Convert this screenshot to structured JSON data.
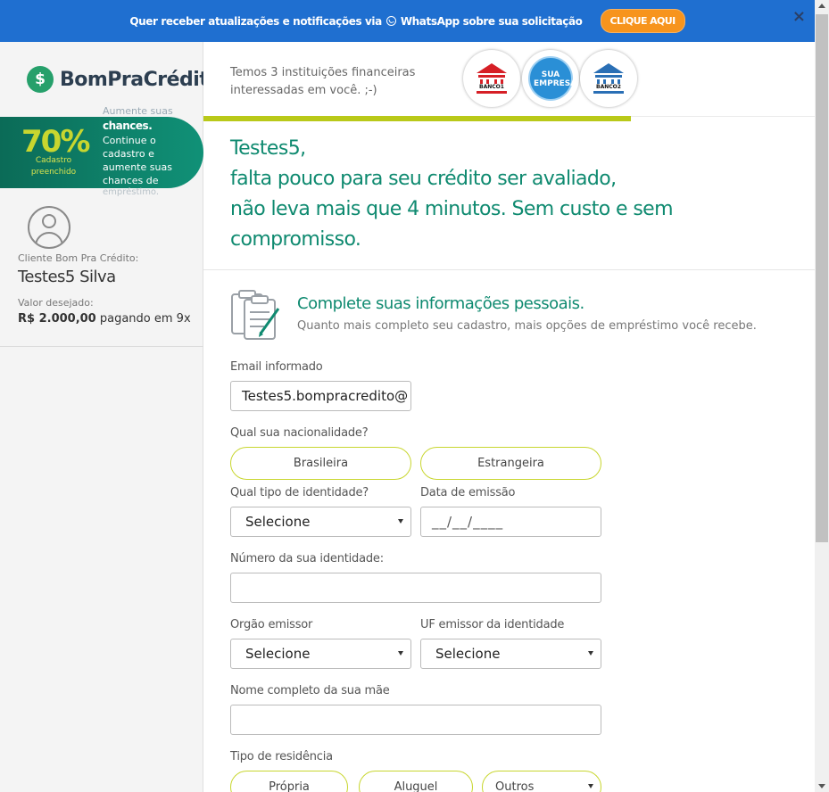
{
  "banner": {
    "text_before": "Quer receber atualizações e notificações via",
    "text_after": "WhatsApp sobre sua solicitação",
    "button": "CLIQUE AQUI",
    "close": "×"
  },
  "sidebar": {
    "logo_symbol": "$",
    "logo_text": "BomPraCrédito",
    "progress": {
      "percent_text": "70%",
      "percent_value": 70,
      "caption": "Cadastro preenchido",
      "faded_line": "Aumente suas",
      "strong_line": "chances.",
      "body": "Continue o cadastro e aumente suas chances de",
      "faded_tail": "empréstimo."
    },
    "client_label": "Cliente Bom Pra Crédito:",
    "client_name": "Testes5 Silva",
    "valor_label": "Valor desejado:",
    "valor_amount": "R$ 2.000,00",
    "valor_terms": "pagando em 9x"
  },
  "institutions": {
    "text": "Temos 3 instituições financeiras interessadas em você. ;-)",
    "banks": [
      {
        "label": "BANCO1",
        "color": "#d61f26"
      },
      {
        "label": "SUA EMPRESA",
        "color": "#2a8fd6"
      },
      {
        "label": "BANCO2",
        "color": "#2a6fb5"
      }
    ]
  },
  "headline": {
    "line1": "Testes5,",
    "line2": "falta pouco para seu crédito ser avaliado,",
    "line3": "não leva mais que 4 minutos. Sem custo e sem",
    "line4": "compromisso."
  },
  "section": {
    "title": "Complete suas informações pessoais.",
    "subtitle": "Quanto mais completo seu cadastro, mais opções de empréstimo você recebe."
  },
  "form": {
    "email_label": "Email informado",
    "email_value": "Testes5.bompracredito@",
    "nationality_label": "Qual sua nacionalidade?",
    "nationality_options": [
      "Brasileira",
      "Estrangeira"
    ],
    "id_type_label": "Qual tipo de identidade?",
    "id_type_value": "Selecione",
    "issue_date_label": "Data de emissão",
    "issue_date_mask": "__/__/____",
    "id_number_label": "Número da sua identidade:",
    "issuer_label": "Orgão emissor",
    "issuer_value": "Selecione",
    "uf_label": "UF emissor da identidade",
    "uf_value": "Selecione",
    "mother_label": "Nome completo da sua mãe",
    "residence_label": "Tipo de residência",
    "residence_options": [
      "Própria",
      "Aluguel",
      "Outros"
    ]
  },
  "colors": {
    "banner": "#1f6fd0",
    "accent_green": "#0f8a70",
    "lime": "#c8d62f",
    "orange": "#f7941d"
  }
}
